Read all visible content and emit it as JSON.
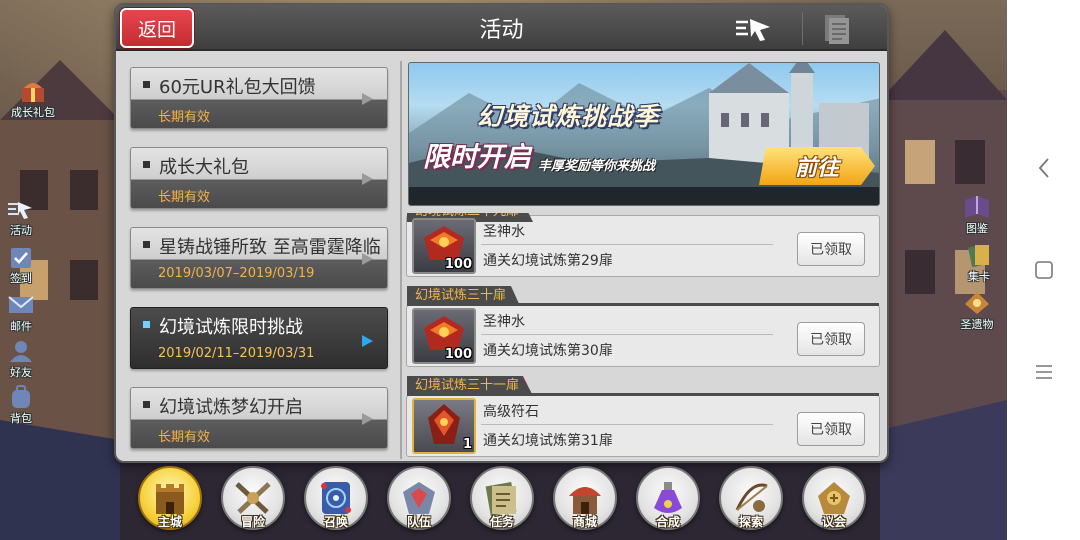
{
  "dialog": {
    "back_label": "返回",
    "title": "活动"
  },
  "left_tabs": [
    {
      "title": "60元UR礼包大回馈",
      "subtitle": "长期有效",
      "active": false
    },
    {
      "title": "成长大礼包",
      "subtitle": "长期有效",
      "active": false
    },
    {
      "title": "星铸战锤所致 至高雷霆降临",
      "subtitle": "2019/03/07–2019/03/19",
      "active": false
    },
    {
      "title": "幻境试炼限时挑战",
      "subtitle": "2019/02/11–2019/03/31",
      "active": true
    },
    {
      "title": "幻境试炼梦幻开启",
      "subtitle": "长期有效",
      "active": false
    }
  ],
  "banner": {
    "title": "幻境试炼挑战季",
    "big_text": "限时开启",
    "subtitle": "丰厚奖励等你来挑战",
    "go_label": "前往"
  },
  "rewards": [
    {
      "stage": "幻境试炼二十九扉",
      "item": "圣神水",
      "qty": "100",
      "desc": "通关幻境试炼第29扉",
      "button": "已领取"
    },
    {
      "stage": "幻境试炼三十扉",
      "item": "圣神水",
      "qty": "100",
      "desc": "通关幻境试炼第30扉",
      "button": "已领取"
    },
    {
      "stage": "幻境试炼三十一扉",
      "item": "高级符石",
      "qty": "1",
      "desc": "通关幻境试炼第31扉",
      "button": "已领取"
    }
  ],
  "left_side_menu": [
    {
      "label": "成长礼包",
      "icon": "gift-icon"
    },
    {
      "label": "活动",
      "icon": "activity-icon"
    },
    {
      "label": "签到",
      "icon": "checkin-icon"
    },
    {
      "label": "邮件",
      "icon": "mail-icon"
    },
    {
      "label": "好友",
      "icon": "friends-icon"
    },
    {
      "label": "背包",
      "icon": "backpack-icon"
    }
  ],
  "right_side_menu": [
    {
      "label": "图鉴",
      "icon": "book-icon"
    },
    {
      "label": "集卡",
      "icon": "cards-icon"
    },
    {
      "label": "圣遗物",
      "icon": "relic-icon"
    }
  ],
  "bottom_nav": [
    {
      "label": "主城",
      "icon": "castle-icon",
      "active": true
    },
    {
      "label": "冒险",
      "icon": "swords-icon",
      "active": false
    },
    {
      "label": "召唤",
      "icon": "summon-icon",
      "active": false
    },
    {
      "label": "队伍",
      "icon": "team-icon",
      "active": false
    },
    {
      "label": "任务",
      "icon": "quest-icon",
      "active": false
    },
    {
      "label": "商城",
      "icon": "shop-icon",
      "active": false
    },
    {
      "label": "合成",
      "icon": "potion-icon",
      "active": false
    },
    {
      "label": "探索",
      "icon": "explore-icon",
      "active": false
    },
    {
      "label": "议会",
      "icon": "council-icon",
      "active": false
    }
  ],
  "colors": {
    "back_button": "#d63a40",
    "subtitle_orange": "#f4b24a",
    "active_accent": "#2ba8ee",
    "go_button": "#f7b82b"
  }
}
